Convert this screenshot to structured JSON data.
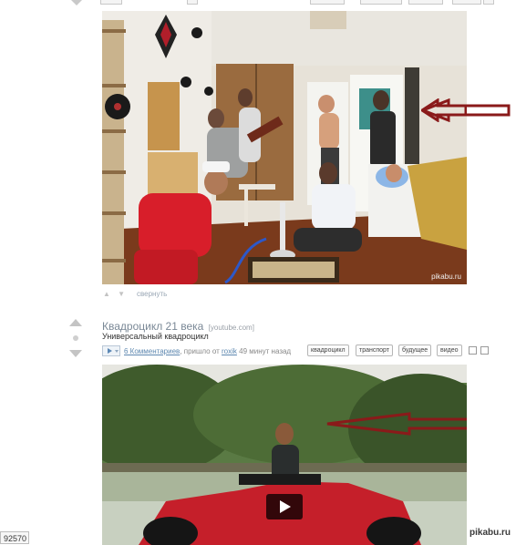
{
  "post1": {
    "image_alt": "Фотография: компания молодых людей в комнате с кальяном",
    "watermark": "pikabu.ru",
    "collapse_label": "свернуть",
    "vote_glyphs": "▲ ▼"
  },
  "post2": {
    "title": "Квадроцикл 21 века",
    "source": "[youtube.com]",
    "subtitle": "Универсальный квадроцикл",
    "comments_link": "6 Комментариев",
    "posted_text": ", пришло от",
    "author": "roxik",
    "time_text": "49 минут назад",
    "tags": [
      "квадроцикл",
      "транспорт",
      "будущее",
      "видео"
    ],
    "play_icon": "play-icon"
  },
  "footer": {
    "counter": "92570",
    "site_mark": "pikabu.ru"
  },
  "colors": {
    "arrow": "#8a1a1a",
    "link": "#5e88b0",
    "title": "#7a8896"
  }
}
